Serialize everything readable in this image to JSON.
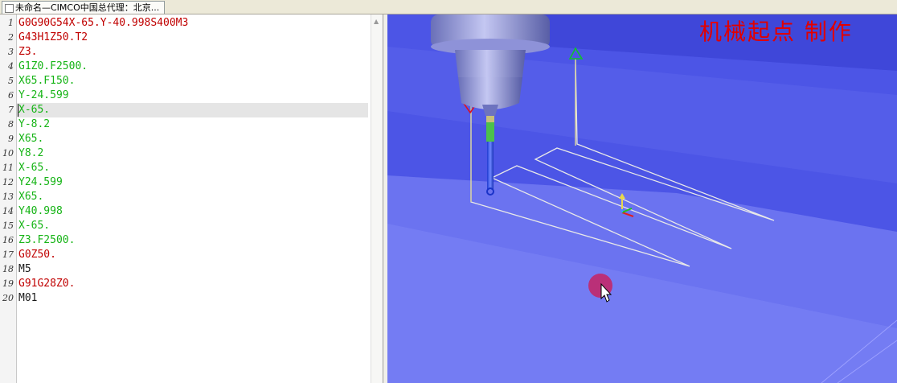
{
  "tab": {
    "title": "未命名—CIMCO中国总代理：北京..."
  },
  "colors": {
    "red_code": "#c00000",
    "green_code": "#16b416",
    "black_code": "#1a1a1a"
  },
  "editor": {
    "current_line": 7,
    "lines": [
      {
        "num": "1",
        "text": "G0G90G54X-65.Y-40.998S400M3",
        "color": "red"
      },
      {
        "num": "2",
        "text": "G43H1Z50.T2",
        "color": "red"
      },
      {
        "num": "3",
        "text": "Z3.",
        "color": "red"
      },
      {
        "num": "4",
        "text": "G1Z0.F2500.",
        "color": "green"
      },
      {
        "num": "5",
        "text": "X65.F150.",
        "color": "green"
      },
      {
        "num": "6",
        "text": "Y-24.599",
        "color": "green"
      },
      {
        "num": "7",
        "text": "X-65.",
        "color": "green"
      },
      {
        "num": "8",
        "text": "Y-8.2",
        "color": "green"
      },
      {
        "num": "9",
        "text": "X65.",
        "color": "green"
      },
      {
        "num": "10",
        "text": "Y8.2",
        "color": "green"
      },
      {
        "num": "11",
        "text": "X-65.",
        "color": "green"
      },
      {
        "num": "12",
        "text": "Y24.599",
        "color": "green"
      },
      {
        "num": "13",
        "text": "X65.",
        "color": "green"
      },
      {
        "num": "14",
        "text": "Y40.998",
        "color": "green"
      },
      {
        "num": "15",
        "text": "X-65.",
        "color": "green"
      },
      {
        "num": "16",
        "text": "Z3.F2500.",
        "color": "green"
      },
      {
        "num": "17",
        "text": "G0Z50.",
        "color": "red"
      },
      {
        "num": "18",
        "text": "M5",
        "color": "black"
      },
      {
        "num": "19",
        "text": "G91G28Z0.",
        "color": "red"
      },
      {
        "num": "20",
        "text": "M01",
        "color": "black"
      }
    ]
  },
  "viewport": {
    "watermark": "机械起点  制作"
  }
}
